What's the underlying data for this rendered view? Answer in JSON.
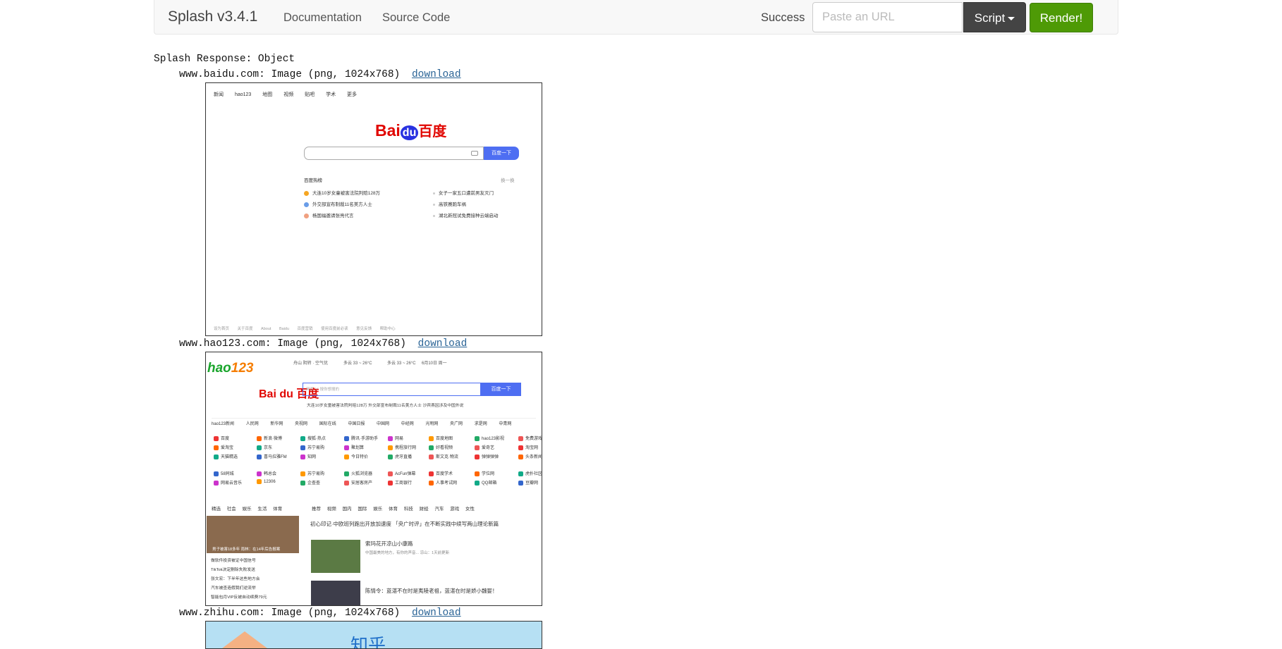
{
  "navbar": {
    "brand": "Splash v3.4.1",
    "links": [
      "Documentation",
      "Source Code"
    ],
    "status": "Success",
    "url_placeholder": "Paste an URL",
    "script_label": "Script",
    "render_label": "Render!"
  },
  "response": {
    "title": "Splash Response: Object",
    "download_label": "download",
    "entries": [
      {
        "key": "www.baidu.com:",
        "desc": "Image (png, 1024x768)"
      },
      {
        "key": "www.hao123.com:",
        "desc": "Image (png, 1024x768)"
      },
      {
        "key": "www.zhihu.com:",
        "desc": "Image (png, 1024x768)"
      }
    ]
  },
  "baidu": {
    "top_links": "新闻 hao123 地图 视频 贴吧 学术 更多",
    "logo_bai": "Bai",
    "logo_du": "du",
    "logo_cn": "百度",
    "button": "百度一下",
    "hot_title": "百度热榜",
    "refresh": "换一换",
    "hot_items": [
      "大连10岁女童被害法院判赔128万",
      "外交部宣布制裁11名美方人士",
      "杨国福邀请张亮代言",
      "女子一家五口遭前男友灭门",
      "高铁赛跑车祸",
      "湖北新冠试免费接种云端启动"
    ],
    "footer": "设为首页 关于百度 About Baidu 百度营销 使用百度前必读 意见反馈 帮助中心"
  },
  "hao123": {
    "logo_hao": "hao",
    "logo_num": "123",
    "weather": [
      "舟山 阴转 · 空气优",
      "多云 33 ~ 26°C",
      "多云 33 ~ 26°C",
      "6月10日 周一"
    ],
    "baidu": "Bai du 百度",
    "search_hint": "网页 ∨   搜你想搜的",
    "button": "百度一下",
    "hot": "大连10岁女童被害法院判赔128万  外交部宣布制裁11名美方人士  沙宾燕因涉及中国外说",
    "nav": "hao123新闻 人民网 新华网 央视网 国际在线 中国日报 中国网 中经网 光明网 央广网 求是网 中青网",
    "grid": [
      [
        "百度",
        "新浪·微博",
        "搜狐·热点",
        "腾讯·手游助手",
        "网易",
        "百度地图",
        "hao123影视",
        "免费游戏"
      ],
      [
        "爱淘宝",
        "京东",
        "苏宁易购",
        "聚划算",
        "携程旅行网",
        "好看视频",
        "爱奇艺",
        "淘宝网"
      ],
      [
        "天猫精选",
        "喜马拉雅FM",
        "知网",
        "今日特价",
        "虎牙直播",
        "斯文克·物流",
        "弹弹弹弹",
        "头条新闻"
      ],
      [
        "58同城",
        "韩总会",
        "苏宁易购",
        "火狐浏览器",
        "AcFun弹幕",
        "百度学术",
        "学位网",
        "虎扑社区"
      ],
      [
        "网易云音乐",
        "12306",
        "企查查",
        "安居客房产",
        "工商银行",
        "人事考试网",
        "QQ邮箱",
        "豆瓣网"
      ]
    ],
    "tabs_left": "精选 社会 娱乐 生活 体育",
    "tabs_right": "推荐 视频 国内 国际 娱乐 体育 科技 财经 汽车 游戏 女性",
    "photo_caption": "男子被害18多年 雨林：在14年后告报案",
    "list": [
      "做软件投资被证中国信号",
      "TikTok决定删除失败发送",
      "张文宏：下半年这些地方会",
      "汽车被查造假我们逆流举",
      "智能包月VIP反被自动续费79元"
    ],
    "news1": "初心印记·中欧班列跑出开放加速度     「央广时评」在不断实践中续写两山理论新篇",
    "news2": "索玛花开凉山小康路",
    "news2_sub": "中国最美的地方，有你的声音... 凉山：1天前更新",
    "news3": "陈情令：蓝湛不在时是夷陵老祖，蓝湛在时是娇小魏婴！"
  },
  "zhihu": {
    "banner": "知乎"
  }
}
